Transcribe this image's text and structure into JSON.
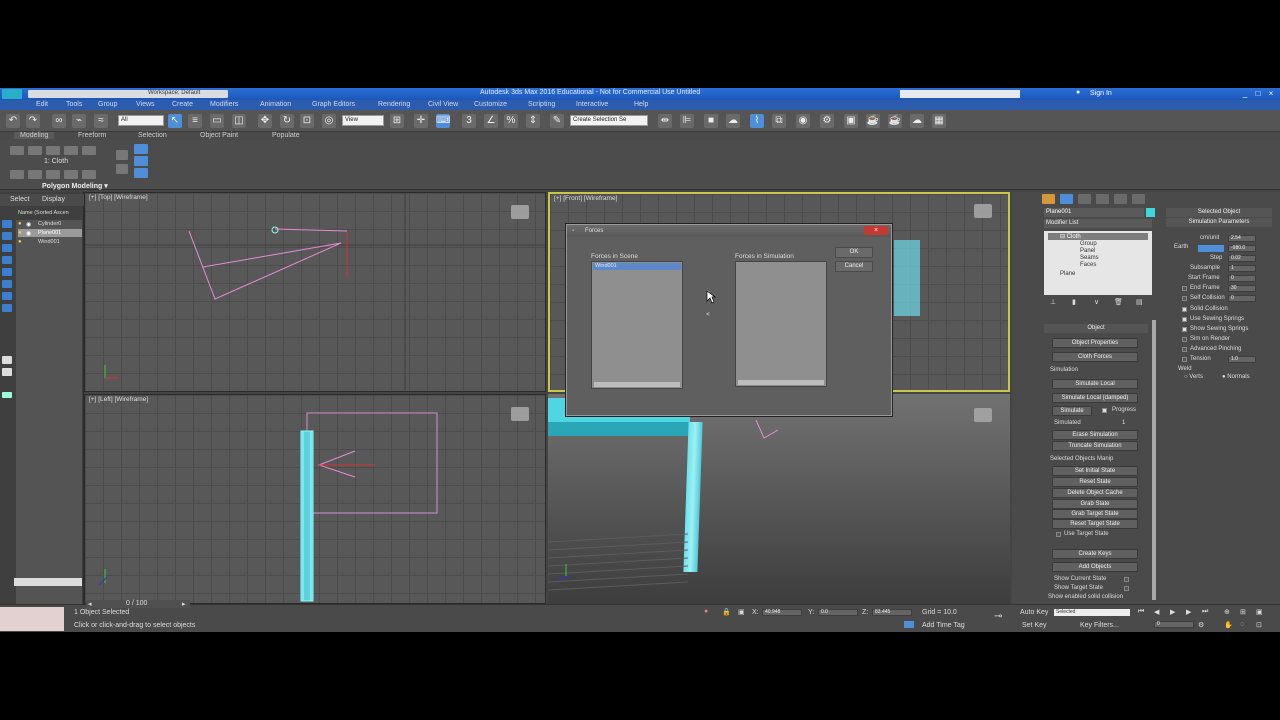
{
  "titlebar": {
    "workspace": "Workspace: Default",
    "title": "Autodesk 3ds Max 2016 Educational - Not for Commercial Use   Untitled",
    "sign_in": "Sign In"
  },
  "menu": [
    "Edit",
    "Tools",
    "Group",
    "Views",
    "Create",
    "Modifiers",
    "Animation",
    "Graph Editors",
    "Rendering",
    "Civil View",
    "Customize",
    "Scripting",
    "Interactive",
    "Help"
  ],
  "toolbar": {
    "filter_value": "All",
    "view_value": "View",
    "selection_set": "Create Selection Se"
  },
  "ribbon": {
    "tabs": [
      "Modeling",
      "Freeform",
      "Selection",
      "Object Paint",
      "Populate"
    ],
    "level_label": "1: Cloth",
    "group_label": "Polygon Modeling"
  },
  "scene_explorer": {
    "tabs": [
      "Select",
      "Display"
    ],
    "header": "Name (Sorted Ascen",
    "items": [
      "Cylinder0",
      "Plane001",
      "Wind001"
    ]
  },
  "viewports": {
    "top": "[+] [Top] [Wireframe]",
    "front": "[+] [Front] [Wireframe]",
    "left": "[+] [Left] [Wireframe]"
  },
  "dialog": {
    "title": "Forces",
    "scene_label": "Forces in Scene",
    "sim_label": "Forces in Simulation",
    "scene_items": [
      "Wind001"
    ],
    "add_btn": ">",
    "remove_btn": "<",
    "ok": "OK",
    "cancel": "Cancel"
  },
  "command_panel": {
    "object_name": "Plane001",
    "modifier_list": "Modifier List",
    "stack": [
      "Cloth",
      "Group",
      "Panel",
      "Seams",
      "Faces",
      "Plane"
    ],
    "object_rollout": "Object",
    "object_props": "Object Properties",
    "cloth_forces": "Cloth Forces",
    "simulation_label": "Simulation",
    "simulate_local": "Simulate Local",
    "simulate_local_damped": "Simulate Local (damped)",
    "simulate": "Simulate",
    "progress": "Progress",
    "simulated": "Simulated",
    "simulated_frame": "1",
    "erase_sim": "Erase Simulation",
    "truncate_sim": "Truncate Simulation",
    "sel_obj_manip": "Selected Objects Manip",
    "set_initial": "Set Initial State",
    "reset_state": "Reset State",
    "delete_cache": "Delete Object Cache",
    "grab_state": "Grab State",
    "grab_target": "Grab Target State",
    "reset_target": "Reset Target State",
    "use_target": "Use Target State",
    "create_keys": "Create Keys",
    "add_objects": "Add Objects",
    "show_current": "Show Current State",
    "show_target": "Show Target State",
    "show_enabled": "Show enabled solid collision"
  },
  "sim_params": {
    "selected_object": "Selected Object",
    "header": "Simulation Parameters",
    "cm_unit_label": "cm/unit",
    "cm_unit": "2.54",
    "earth": "Earth",
    "gravity": "-980.0",
    "step_label": "Step",
    "step": "0.02",
    "subsample_label": "Subsample",
    "subsample": "1",
    "start_frame_label": "Start Frame",
    "start_frame": "0",
    "end_frame_label": "End Frame",
    "end_frame": "30",
    "self_collision_label": "Self Collision",
    "self_collision": "0",
    "solid_collision": "Solid Collision",
    "use_sewing": "Use Sewing Springs",
    "show_sewing": "Show Sewing Springs",
    "sim_on_render": "Sim on Render",
    "adv_pinching": "Advanced Pinching",
    "tension_label": "Tension",
    "tension": "1.0",
    "weld": "Weld",
    "verts": "Verts",
    "normals": "Normals"
  },
  "status": {
    "timeline": "0 / 100",
    "selected": "1 Object Selected",
    "hint": "Click or click-and-drag to select objects",
    "x": "40.948",
    "y": "0.0",
    "z": "83.445",
    "grid": "Grid = 10.0",
    "add_time_tag": "Add Time Tag",
    "auto_key": "Auto Key",
    "set_key": "Set Key",
    "selected_mode": "Selected",
    "key_filters": "Key Filters...",
    "frame": "0"
  }
}
